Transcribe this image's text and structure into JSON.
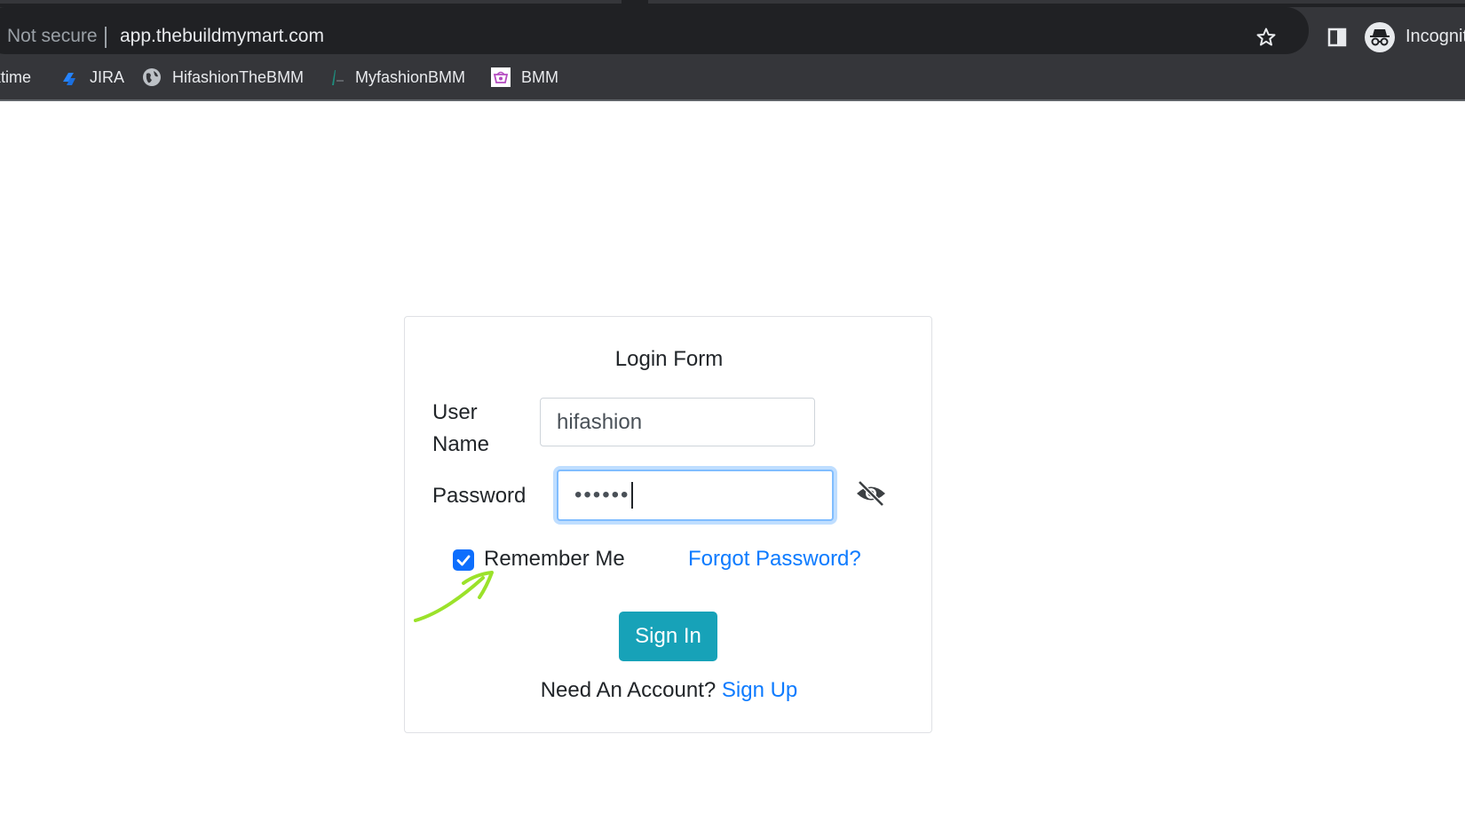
{
  "browser": {
    "security_label": "Not secure",
    "url": "app.thebuildmymart.com",
    "profile_label": "Incognito",
    "bookmarks": [
      {
        "label": "ktime",
        "icon": "none"
      },
      {
        "label": "JIRA",
        "icon": "jira-icon"
      },
      {
        "label": "HifashionTheBMM",
        "icon": "globe-icon"
      },
      {
        "label": "MyfashionBMM",
        "icon": "myfashion-icon"
      },
      {
        "label": "BMM",
        "icon": "bmm-icon"
      }
    ]
  },
  "login": {
    "title": "Login Form",
    "username_label": "User Name",
    "username_value": "hifashion",
    "password_label": "Password",
    "password_masked": "••••••",
    "remember_label": "Remember Me",
    "remember_checked": true,
    "forgot_label": "Forgot Password?",
    "signin_label": "Sign In",
    "need_account_text": "Need An Account?",
    "signup_label": "Sign Up"
  },
  "colors": {
    "chrome_dark": "#202124",
    "chrome_bar": "#35363a",
    "button_teal": "#17a2b8",
    "link_blue": "#0d7bff",
    "checkbox_blue": "#0d6efd",
    "annotation_green": "#9be22a"
  }
}
